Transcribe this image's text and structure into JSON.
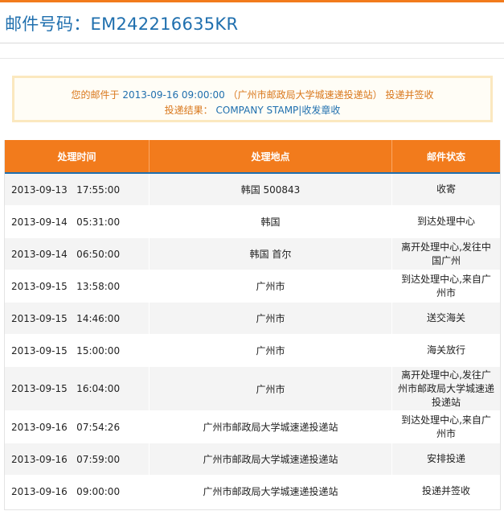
{
  "header": {
    "title": "邮件号码：EM242216635KR"
  },
  "notice": {
    "line1_prefix": "您的邮件于",
    "datetime": "2013-09-16 09:00:00",
    "location": "（广州市邮政局大学城速递投递站）",
    "line1_suffix": "投递并签收",
    "line2_label": "投递结果：",
    "line2_value": "COMPANY STAMP|收发章收"
  },
  "table": {
    "headers": [
      "处理时间",
      "处理地点",
      "邮件状态"
    ],
    "rows": [
      {
        "time": "2013-09-13   17:55:00",
        "place": "韩国  500843",
        "status": "收寄"
      },
      {
        "time": "2013-09-14   05:31:00",
        "place": "韩国",
        "status": "到达处理中心"
      },
      {
        "time": "2013-09-14   06:50:00",
        "place": "韩国  首尔",
        "status": "离开处理中心,发往中国广州"
      },
      {
        "time": "2013-09-15   13:58:00",
        "place": "广州市",
        "status": "到达处理中心,来自广州市"
      },
      {
        "time": "2013-09-15   14:46:00",
        "place": "广州市",
        "status": "送交海关"
      },
      {
        "time": "2013-09-15   15:00:00",
        "place": "广州市",
        "status": "海关放行"
      },
      {
        "time": "2013-09-15   16:04:00",
        "place": "广州市",
        "status": "离开处理中心,发往广州市邮政局大学城速递投递站"
      },
      {
        "time": "2013-09-16   07:54:26",
        "place": "广州市邮政局大学城速递投递站",
        "status": "到达处理中心,来自广州市"
      },
      {
        "time": "2013-09-16   07:59:00",
        "place": "广州市邮政局大学城速递投递站",
        "status": "安排投递"
      },
      {
        "time": "2013-09-16   09:00:00",
        "place": "广州市邮政局大学城速递投递站",
        "status": "投递并签收"
      }
    ]
  }
}
